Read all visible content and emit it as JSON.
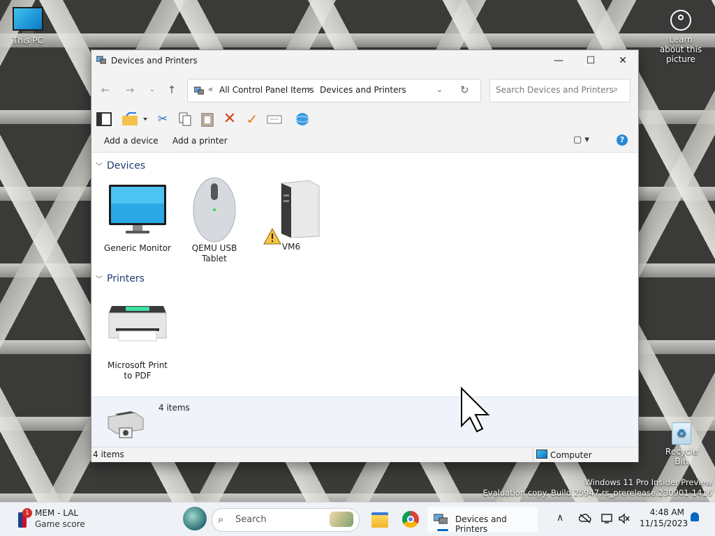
{
  "desktop": {
    "this_pc_label": "This PC",
    "learn_about_label": "Learn about this picture",
    "recycle_bin_label": "Recycle Bin",
    "watermark_line1": "Windows 11 Pro Insider Preview",
    "watermark_line2": "Evaluation copy. Build 25947.rs_prerelease.230901-1416"
  },
  "window": {
    "title": "Devices and Printers",
    "caption": {
      "minimize": "—",
      "maximize": "☐",
      "close": "✕"
    },
    "nav": {
      "back": "←",
      "forward": "→",
      "recent": "⌄",
      "up": "↑"
    },
    "address": {
      "overflow": "«",
      "crumbs": [
        "All Control Panel Items",
        "Devices and Printers"
      ],
      "separator": "›",
      "dropdown": "⌄",
      "refresh": "↻"
    },
    "search": {
      "placeholder": "Search Devices and Printers",
      "icon": "⌕"
    },
    "commands": {
      "add_device": "Add a device",
      "add_printer": "Add a printer",
      "view": "▢ ▾",
      "help": "?"
    },
    "groups": [
      {
        "name": "Devices",
        "items": [
          {
            "label": "Generic Monitor",
            "icon": "monitor-icon"
          },
          {
            "label": "QEMU USB Tablet",
            "icon": "mouse-icon"
          },
          {
            "label": "VM6",
            "icon": "computer-tower-icon",
            "warning": true
          }
        ]
      },
      {
        "name": "Printers",
        "items": [
          {
            "label": "Microsoft Print to PDF",
            "icon": "printer-icon"
          }
        ]
      }
    ],
    "details_count": "4 items",
    "status": {
      "count": "4 items",
      "zone": "Computer"
    }
  },
  "taskbar": {
    "widget": {
      "badge": "1",
      "title": "MEM - LAL",
      "subtitle": "Game score"
    },
    "search_label": "Search",
    "active_app_label": "Devices and Printers",
    "tray": {
      "chevron": "∧"
    },
    "clock": {
      "time": "4:48 AM",
      "date": "11/15/2023"
    }
  },
  "colors": {
    "accent": "#0067c0",
    "help": "#2a87d6",
    "group_header": "#1f3b73"
  }
}
